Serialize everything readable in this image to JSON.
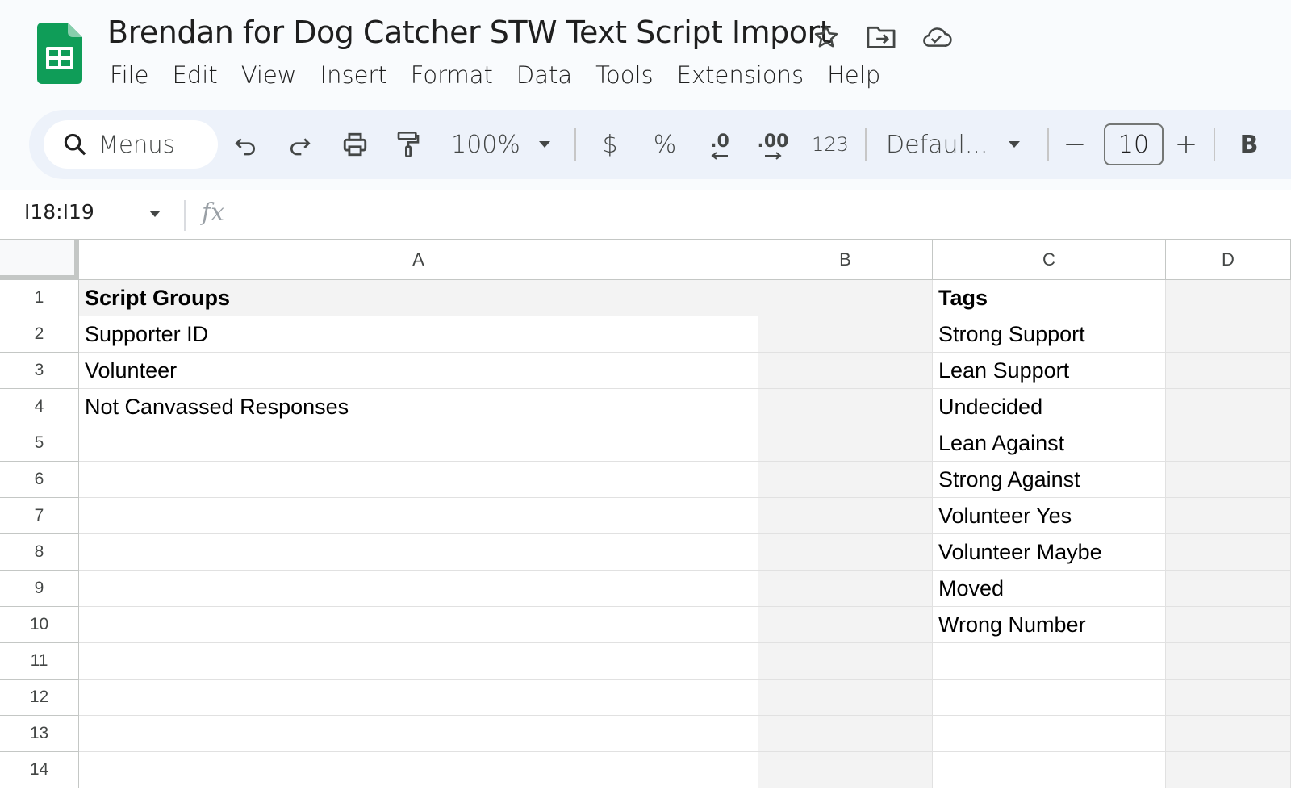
{
  "app": {
    "title": "Brendan for Dog Catcher STW Text Script Import",
    "brand_color": "#0f9d58"
  },
  "menu": [
    "File",
    "Edit",
    "View",
    "Insert",
    "Format",
    "Data",
    "Tools",
    "Extensions",
    "Help"
  ],
  "toolbar": {
    "search_label": "Menus",
    "zoom": "100%",
    "currency": "$",
    "percent": "%",
    "decrease_decimal": ".0",
    "increase_decimal": ".00",
    "number_format": "123",
    "font": "Defaul...",
    "font_size": "10",
    "minus": "−",
    "plus": "+",
    "bold": "B"
  },
  "formula_bar": {
    "name_box": "I18:I19",
    "fx_label": "fx",
    "formula": ""
  },
  "grid": {
    "columns": [
      "A",
      "B",
      "C",
      "D"
    ],
    "rows": [
      {
        "num": "1",
        "A": "Script Groups",
        "B": "",
        "C": "Tags",
        "D": ""
      },
      {
        "num": "2",
        "A": "Supporter ID",
        "B": "",
        "C": "Strong Support",
        "D": ""
      },
      {
        "num": "3",
        "A": "Volunteer",
        "B": "",
        "C": "Lean Support",
        "D": ""
      },
      {
        "num": "4",
        "A": "Not Canvassed Responses",
        "B": "",
        "C": "Undecided",
        "D": ""
      },
      {
        "num": "5",
        "A": "",
        "B": "",
        "C": "Lean Against",
        "D": ""
      },
      {
        "num": "6",
        "A": "",
        "B": "",
        "C": "Strong Against",
        "D": ""
      },
      {
        "num": "7",
        "A": "",
        "B": "",
        "C": "Volunteer Yes",
        "D": ""
      },
      {
        "num": "8",
        "A": "",
        "B": "",
        "C": "Volunteer Maybe",
        "D": ""
      },
      {
        "num": "9",
        "A": "",
        "B": "",
        "C": "Moved",
        "D": ""
      },
      {
        "num": "10",
        "A": "",
        "B": "",
        "C": "Wrong Number",
        "D": ""
      },
      {
        "num": "11",
        "A": "",
        "B": "",
        "C": "",
        "D": ""
      },
      {
        "num": "12",
        "A": "",
        "B": "",
        "C": "",
        "D": ""
      },
      {
        "num": "13",
        "A": "",
        "B": "",
        "C": "",
        "D": ""
      },
      {
        "num": "14",
        "A": "",
        "B": "",
        "C": "",
        "D": ""
      }
    ]
  }
}
